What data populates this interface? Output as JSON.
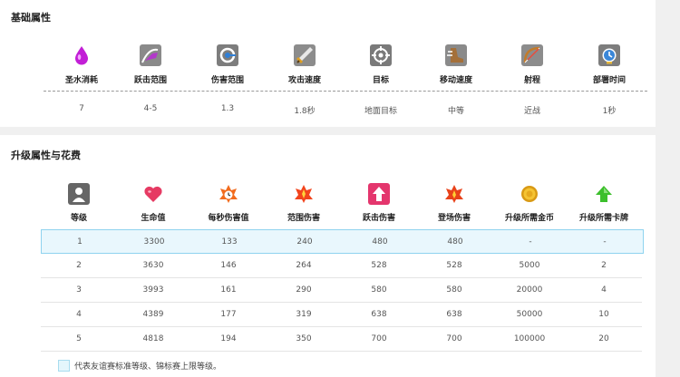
{
  "basic": {
    "title": "基础属性",
    "stats": [
      {
        "label": "圣水消耗",
        "value": "7",
        "icon": "elixir-drop-icon"
      },
      {
        "label": "跃击范围",
        "value": "4-5",
        "icon": "jump-range-icon"
      },
      {
        "label": "伤害范围",
        "value": "1.3",
        "icon": "damage-range-icon"
      },
      {
        "label": "攻击速度",
        "value": "1.8秒",
        "icon": "attack-speed-icon"
      },
      {
        "label": "目标",
        "value": "地面目标",
        "icon": "target-icon"
      },
      {
        "label": "移动速度",
        "value": "中等",
        "icon": "move-speed-icon"
      },
      {
        "label": "射程",
        "value": "近战",
        "icon": "range-icon"
      },
      {
        "label": "部署时间",
        "value": "1秒",
        "icon": "deploy-time-icon"
      }
    ]
  },
  "upgrade": {
    "title": "升级属性与花费",
    "headers": [
      {
        "label": "等级",
        "icon": "level-icon"
      },
      {
        "label": "生命值",
        "icon": "heart-icon"
      },
      {
        "label": "每秒伤害值",
        "icon": "dps-icon"
      },
      {
        "label": "范围伤害",
        "icon": "area-damage-icon"
      },
      {
        "label": "跃击伤害",
        "icon": "jump-damage-icon"
      },
      {
        "label": "登场伤害",
        "icon": "deploy-damage-icon"
      },
      {
        "label": "升级所需金币",
        "icon": "gold-coin-icon"
      },
      {
        "label": "升级所需卡牌",
        "icon": "green-arrow-up-icon"
      }
    ],
    "rows": [
      [
        "1",
        "3300",
        "133",
        "240",
        "480",
        "480",
        "-",
        "-"
      ],
      [
        "2",
        "3630",
        "146",
        "264",
        "528",
        "528",
        "5000",
        "2"
      ],
      [
        "3",
        "3993",
        "161",
        "290",
        "580",
        "580",
        "20000",
        "4"
      ],
      [
        "4",
        "4389",
        "177",
        "319",
        "638",
        "638",
        "50000",
        "10"
      ],
      [
        "5",
        "4818",
        "194",
        "350",
        "700",
        "700",
        "100000",
        "20"
      ]
    ],
    "highlighted_row": 0,
    "legend": "代表友谊赛标准等级、锦标赛上限等级。"
  },
  "colors": {
    "highlight_bg": "#e9f7fd",
    "highlight_border": "#8fd3ef"
  }
}
